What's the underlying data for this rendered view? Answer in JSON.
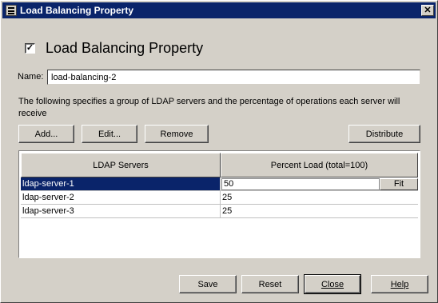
{
  "window": {
    "title": "Load Balancing Property"
  },
  "header": {
    "title": "Load Balancing Property",
    "checked": "✓"
  },
  "name_field": {
    "label": "Name:",
    "value": "load-balancing-2"
  },
  "description": "The following specifies a group of LDAP servers and the percentage of operations each server will receive",
  "toolbar": {
    "add": "Add...",
    "edit": "Edit...",
    "remove": "Remove",
    "distribute": "Distribute"
  },
  "table": {
    "columns": [
      "LDAP Servers",
      "Percent Load  (total=100)"
    ],
    "rows": [
      {
        "server": "ldap-server-1",
        "percent": "50"
      },
      {
        "server": "ldap-server-2",
        "percent": "25"
      },
      {
        "server": "ldap-server-3",
        "percent": "25"
      }
    ],
    "fit_label": "Fit"
  },
  "footer": {
    "save": "Save",
    "reset": "Reset",
    "close": "Close",
    "help": "Help"
  },
  "colors": {
    "titlebar": "#0a246a",
    "background": "#d4d0c8",
    "selection": "#0a246a"
  },
  "icons": [
    "app-icon",
    "close-icon",
    "checkbox-checked-icon"
  ]
}
